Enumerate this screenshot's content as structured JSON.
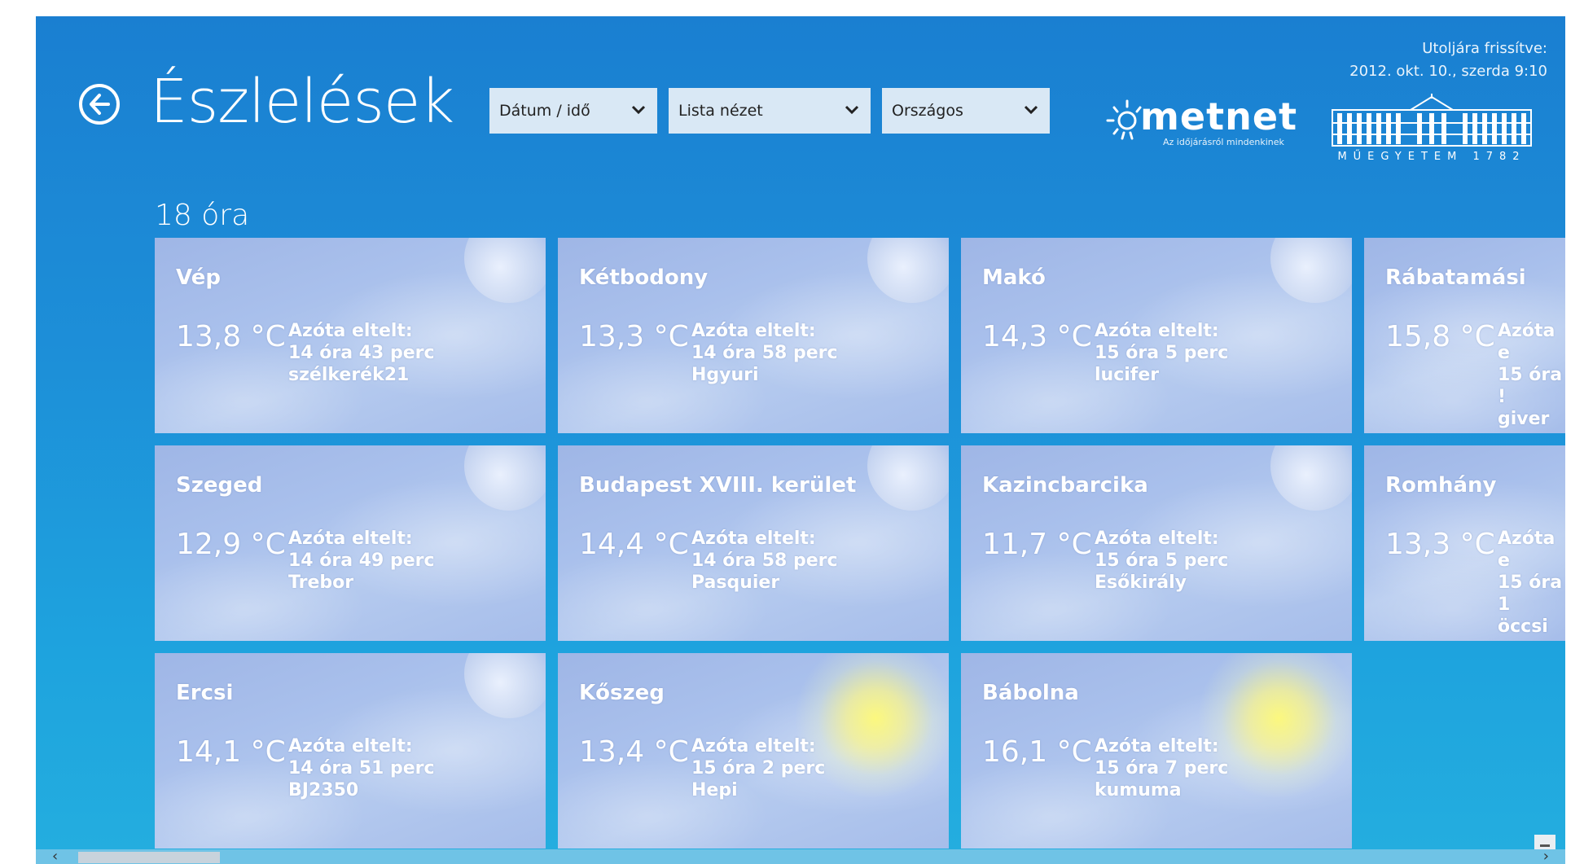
{
  "header": {
    "title": "Észlelések",
    "back_icon": "arrow-left-icon",
    "updated_label": "Utoljára frissítve:",
    "updated_value": "2012. okt. 10., szerda  9:10"
  },
  "filters": [
    {
      "label": "Dátum / idő"
    },
    {
      "label": "Lista nézet"
    },
    {
      "label": "Országos"
    }
  ],
  "logos": {
    "metnet_name": "metnet",
    "metnet_tagline": "Az időjárásról mindenkinek",
    "muegyetem_text": "MŰEGYETEM 1782"
  },
  "section": {
    "heading": "18 óra"
  },
  "tiles": [
    {
      "city": "Vép",
      "temp": "13,8 °C",
      "elapsed_label": "Azóta eltelt:",
      "elapsed": "14 óra 43 perc",
      "user": "szélkerék21",
      "bg": "moon"
    },
    {
      "city": "Kétbodony",
      "temp": "13,3 °C",
      "elapsed_label": "Azóta eltelt:",
      "elapsed": "14 óra 58 perc",
      "user": "Hgyuri",
      "bg": "moon"
    },
    {
      "city": "Makó",
      "temp": "14,3 °C",
      "elapsed_label": "Azóta eltelt:",
      "elapsed": "15 óra 5 perc",
      "user": "lucifer",
      "bg": "moon"
    },
    {
      "city": "Rábatamási",
      "temp": "15,8 °C",
      "elapsed_label": "Azóta e",
      "elapsed": "15 óra !",
      "user": "giver",
      "bg": "moon"
    },
    {
      "city": "Szeged",
      "temp": "12,9 °C",
      "elapsed_label": "Azóta eltelt:",
      "elapsed": "14 óra 49 perc",
      "user": "Trebor",
      "bg": "moon"
    },
    {
      "city": "Budapest XVIII. kerület",
      "temp": "14,4 °C",
      "elapsed_label": "Azóta eltelt:",
      "elapsed": "14 óra 58 perc",
      "user": "Pasquier",
      "bg": "moon"
    },
    {
      "city": "Kazincbarcika",
      "temp": "11,7 °C",
      "elapsed_label": "Azóta eltelt:",
      "elapsed": "15 óra 5 perc",
      "user": "Esőkirály",
      "bg": "moon"
    },
    {
      "city": "Romhány",
      "temp": "13,3 °C",
      "elapsed_label": "Azóta e",
      "elapsed": "15 óra 1",
      "user": "öccsi",
      "bg": "moon"
    },
    {
      "city": "Ercsi",
      "temp": "14,1 °C",
      "elapsed_label": "Azóta eltelt:",
      "elapsed": "14 óra 51 perc",
      "user": "BJ2350",
      "bg": "moon"
    },
    {
      "city": "Kőszeg",
      "temp": "13,4 °C",
      "elapsed_label": "Azóta eltelt:",
      "elapsed": "15 óra 2 perc",
      "user": "Hepi",
      "bg": "sun"
    },
    {
      "city": "Bábolna",
      "temp": "16,1 °C",
      "elapsed_label": "Azóta eltelt:",
      "elapsed": "15 óra 7 perc",
      "user": "kumuma",
      "bg": "sun"
    }
  ],
  "scroll": {
    "left_icon": "chevron-left-icon",
    "right_icon": "chevron-right-icon"
  },
  "colors": {
    "bg_top": "#1a7fd1",
    "bg_bottom": "#24aedf",
    "dropdown_bg": "#d9e8f5",
    "tile": "#a9c0ec"
  }
}
